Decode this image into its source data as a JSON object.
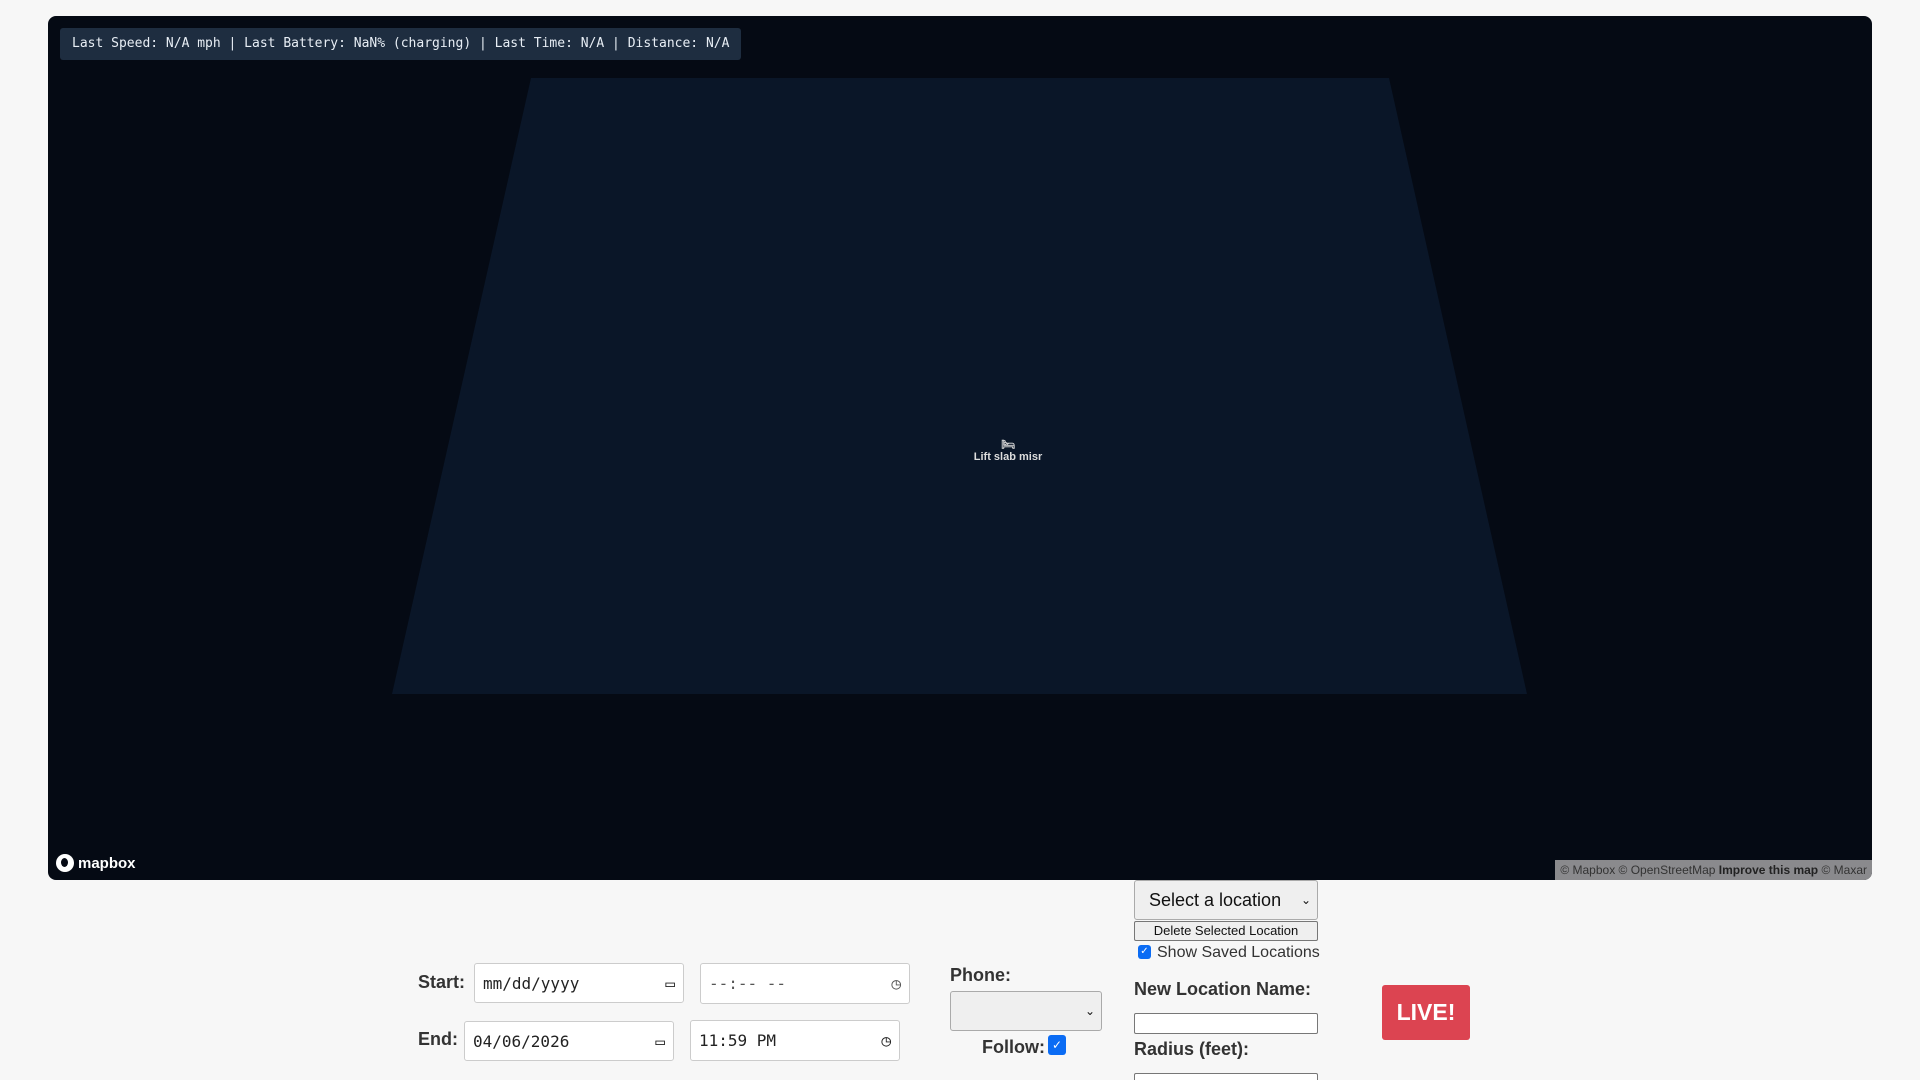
{
  "status_bar": "Last Speed: N/A mph | Last Battery: NaN% (charging) | Last Time: N/A | Distance: N/A",
  "map": {
    "poi_label": "Lift slab misr",
    "logo": "mapbox",
    "attribution": {
      "mapbox": "© Mapbox",
      "osm": "© OpenStreetMap",
      "improve": "Improve this map",
      "maxar": "© Maxar"
    }
  },
  "controls": {
    "start_label": "Start:",
    "start_date": "mm/dd/yyyy",
    "start_time": "--:-- --",
    "end_label": "End:",
    "end_date": "04/06/2026",
    "end_time": "11:59 PM",
    "phone_label": "Phone:",
    "phone_value": "",
    "follow_label": "Follow:",
    "follow_checked": true,
    "location_select": "Select a location",
    "delete_button": "Delete Selected Location",
    "show_saved_label": "Show Saved Locations",
    "show_saved_checked": true,
    "new_location_label": "New Location Name:",
    "new_location_value": "",
    "radius_label": "Radius (feet):",
    "live_button": "LIVE!"
  }
}
